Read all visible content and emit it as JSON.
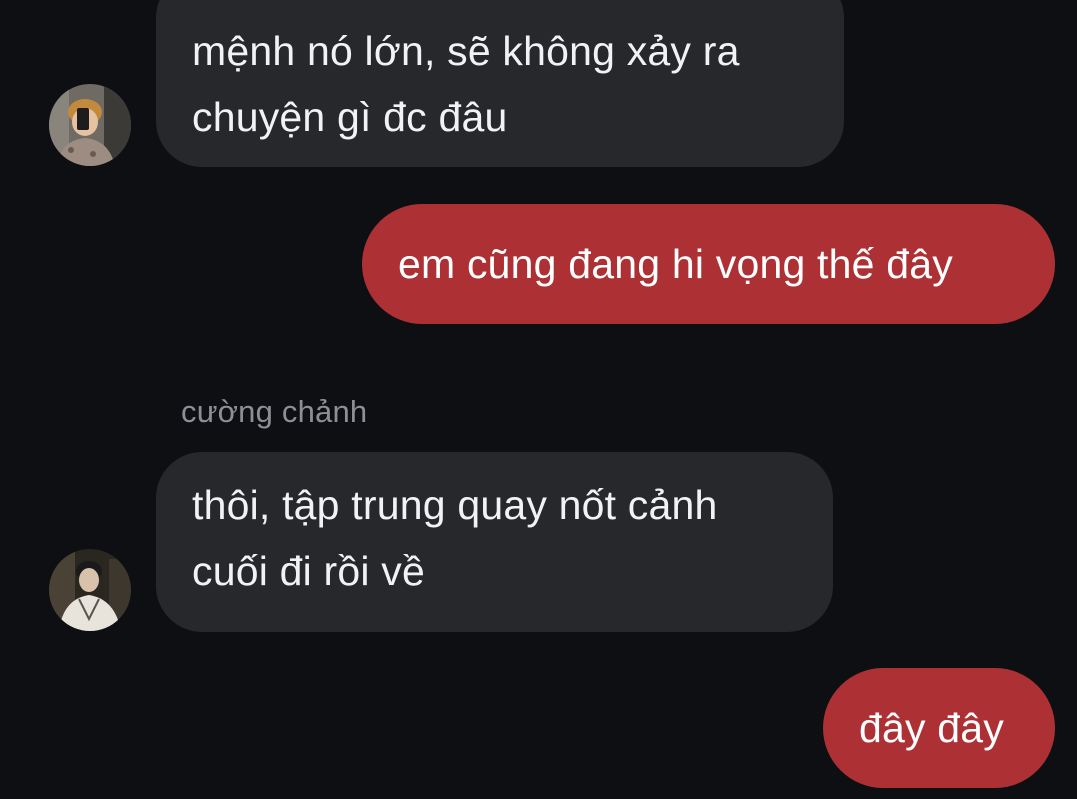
{
  "colors": {
    "background": "#0e0f13",
    "incoming_bubble": "#26282c",
    "outgoing_bubble": "#ad3134",
    "sender_name": "#8d8f96"
  },
  "messages": [
    {
      "direction": "incoming",
      "text": "mệnh nó lớn, sẽ không xảy ra\nchuyện gì đc đâu",
      "avatar_icon": "profile-photo-1"
    },
    {
      "direction": "outgoing",
      "text": "em cũng đang hi vọng thế đây"
    },
    {
      "direction": "incoming",
      "sender": "cường chảnh",
      "text": "thôi, tập trung quay nốt cảnh\ncuối đi rồi về",
      "avatar_icon": "profile-photo-2"
    },
    {
      "direction": "outgoing",
      "text": "đây đây"
    }
  ]
}
